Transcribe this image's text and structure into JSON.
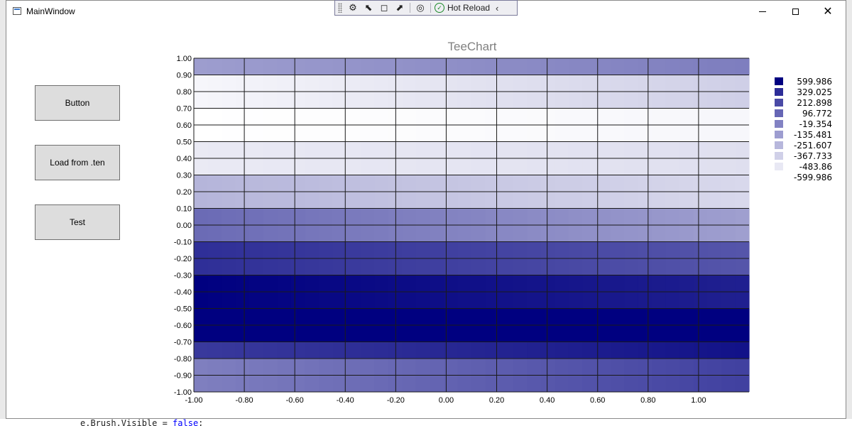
{
  "window": {
    "title": "MainWindow"
  },
  "toolbar": {
    "hot_reload_label": "Hot Reload"
  },
  "buttons": [
    {
      "label": "Button"
    },
    {
      "label": "Load from .ten"
    },
    {
      "label": "Test"
    }
  ],
  "behind_code": {
    "prefix": "e.Brush.Visible = ",
    "keyword": "false",
    "suffix": ";"
  },
  "chart_data": {
    "type": "heatmap",
    "title": "TeeChart",
    "xlabel": "",
    "ylabel": "",
    "xlim": [
      -1.0,
      1.2
    ],
    "ylim": [
      -1.0,
      1.0
    ],
    "x_ticks": [
      "-1.00",
      "-0.80",
      "-0.60",
      "-0.40",
      "-0.20",
      "0.00",
      "0.20",
      "0.40",
      "0.60",
      "0.80",
      "1.00"
    ],
    "y_ticks": [
      "1.00",
      "0.90",
      "0.80",
      "0.70",
      "0.60",
      "0.50",
      "0.40",
      "0.30",
      "0.20",
      "0.10",
      "0.00",
      "-0.10",
      "-0.20",
      "-0.30",
      "-0.40",
      "-0.50",
      "-0.60",
      "-0.70",
      "-0.80",
      "-0.90",
      "-1.00"
    ],
    "grid": true,
    "legend_position": "right",
    "legend": [
      {
        "label": "599.986",
        "color": "#000080"
      },
      {
        "label": "329.025",
        "color": "#2d2d98"
      },
      {
        "label": "212.898",
        "color": "#4a4aa6"
      },
      {
        "label": "96.772",
        "color": "#6666b5"
      },
      {
        "label": "-19.354",
        "color": "#8282c3"
      },
      {
        "label": "-135.481",
        "color": "#9d9dd0"
      },
      {
        "label": "-251.607",
        "color": "#b7b7dc"
      },
      {
        "label": "-367.733",
        "color": "#d0d0e8"
      },
      {
        "label": "-483.86",
        "color": "#e8e8f4"
      },
      {
        "label": "-599.986",
        "color": null
      }
    ],
    "levels": [
      -599.986,
      -483.86,
      -367.733,
      -251.607,
      -135.481,
      -19.354,
      96.772,
      212.898,
      329.025,
      599.986
    ],
    "bands": [
      {
        "y": [
          0.9,
          1.0
        ],
        "value_left": -140,
        "value_right": 10
      },
      {
        "y": [
          0.7,
          0.9
        ],
        "value_left": -560,
        "value_right": -370
      },
      {
        "y": [
          0.5,
          0.7
        ],
        "value_left": -599.986,
        "value_right": -560
      },
      {
        "y": [
          0.3,
          0.5
        ],
        "value_left": -500,
        "value_right": -450
      },
      {
        "y": [
          0.1,
          0.3
        ],
        "value_left": -250,
        "value_right": -420
      },
      {
        "y": [
          -0.1,
          0.1
        ],
        "value_left": 100,
        "value_right": -150
      },
      {
        "y": [
          -0.3,
          -0.1
        ],
        "value_left": 380,
        "value_right": 200
      },
      {
        "y": [
          -0.5,
          -0.3
        ],
        "value_left": 599.986,
        "value_right": 450
      },
      {
        "y": [
          -0.7,
          -0.5
        ],
        "value_left": 599.986,
        "value_right": 599.986
      },
      {
        "y": [
          -0.8,
          -0.7
        ],
        "value_left": 330,
        "value_right": 520
      },
      {
        "y": [
          -1.0,
          -0.8
        ],
        "value_left": 0,
        "value_right": 300
      }
    ]
  }
}
